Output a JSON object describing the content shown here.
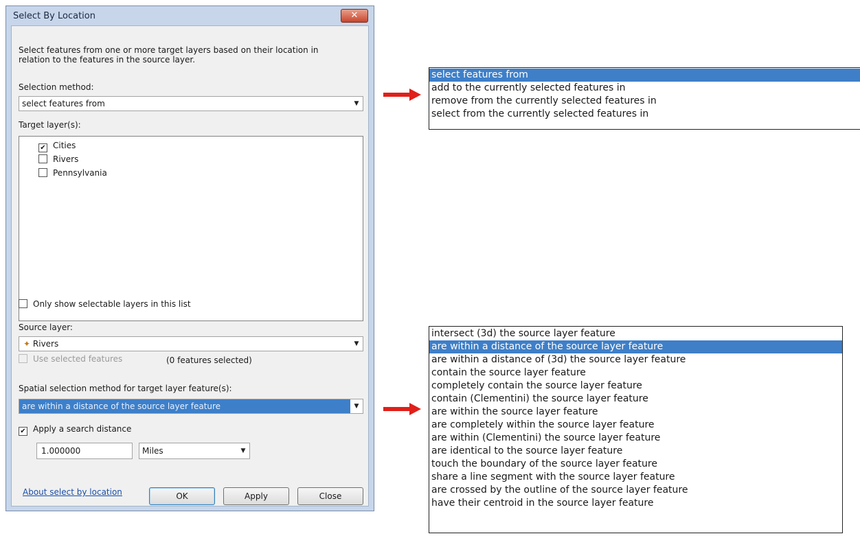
{
  "dialog": {
    "title": "Select By Location",
    "close_glyph": "✕",
    "description": "Select features from one or more target layers based on their location in relation to the features in the source layer.",
    "selection_methods_label": "Selection method:",
    "selection_method_value": "select features from",
    "target_layers_label": "Target layer(s):",
    "target_layers": [
      {
        "name": "Cities",
        "checked": true
      },
      {
        "name": "Rivers",
        "checked": false
      },
      {
        "name": "Pennsylvania",
        "checked": false
      }
    ],
    "only_selectable_label": "Only show selectable layers in this list",
    "source_layer_label": "Source layer:",
    "source_layer_value": "Rivers",
    "use_selected_label": "Use selected features",
    "features_selected_text": "(0 features selected)",
    "spatial_method_label": "Spatial selection method for target layer feature(s):",
    "spatial_method_value": "are within a distance of the source layer feature",
    "apply_search_distance_label": "Apply a search distance",
    "search_distance_value": "1.000000",
    "distance_units_value": "Miles",
    "about_link": "About select by location",
    "ok_label": "OK",
    "apply_label": "Apply",
    "close_label": "Close"
  },
  "selection_method_options": [
    "select features from",
    "add to the currently selected features in",
    "remove from the currently selected features in",
    "select from the currently selected features in"
  ],
  "selection_method_selected_index": 0,
  "spatial_method_options": [
    "intersect (3d) the source layer feature",
    "are within a distance of the source layer feature",
    "are within a distance of (3d) the source layer feature",
    "contain the source layer feature",
    "completely contain the source layer feature",
    "contain (Clementini) the source layer feature",
    "are within the source layer feature",
    "are completely within the source layer feature",
    "are within (Clementini) the source layer feature",
    "are identical to the source layer feature",
    "touch the boundary of the source layer feature",
    "share a line segment with the source layer feature",
    "are crossed by the outline of the source layer feature",
    "have their centroid in the source layer feature"
  ],
  "spatial_method_selected_index": 1,
  "colors": {
    "selection_highlight": "#3e7fc8",
    "arrow": "#e0201a",
    "dialog_frame": "#c7d6ea"
  }
}
